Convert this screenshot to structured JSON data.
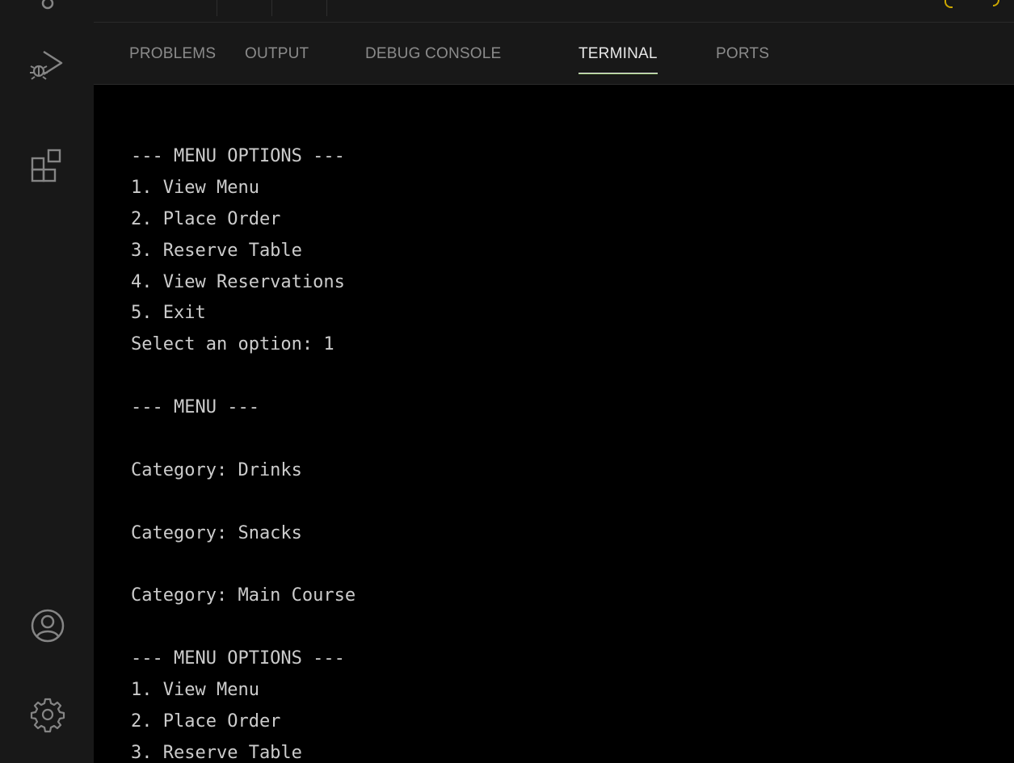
{
  "panel": {
    "tabs": [
      {
        "label": "PROBLEMS"
      },
      {
        "label": "OUTPUT"
      },
      {
        "label": "DEBUG CONSOLE"
      },
      {
        "label": "TERMINAL"
      },
      {
        "label": "PORTS"
      }
    ],
    "active_tab": "TERMINAL"
  },
  "activity_bar": {
    "icons": [
      "source-control-icon",
      "run-debug-icon",
      "extensions-icon",
      "account-icon",
      "settings-icon"
    ]
  },
  "terminal": {
    "lines": [
      "--- MENU OPTIONS ---",
      "1. View Menu",
      "2. Place Order",
      "3. Reserve Table",
      "4. View Reservations",
      "5. Exit",
      "Select an option: 1",
      "",
      "--- MENU ---",
      "",
      "Category: Drinks",
      "",
      "Category: Snacks",
      "",
      "Category: Main Course",
      "",
      "--- MENU OPTIONS ---",
      "1. View Menu",
      "2. Place Order",
      "3. Reserve Table"
    ]
  },
  "colors": {
    "terminal_bg": "#000000",
    "terminal_fg": "#cccccc",
    "panel_bg": "#181818",
    "tab_inactive": "#8b8b8b",
    "tab_active": "#e7e7e7",
    "active_underline": "#8fbf6a"
  }
}
